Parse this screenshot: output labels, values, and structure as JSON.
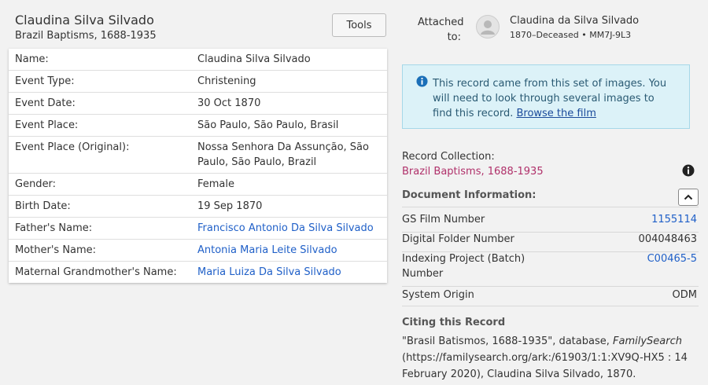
{
  "header": {
    "name": "Claudina Silva Silvado",
    "collection": "Brazil Baptisms, 1688-1935",
    "tools_label": "Tools"
  },
  "record_rows": [
    {
      "label": "Name:",
      "value": "Claudina Silva Silvado",
      "link": false
    },
    {
      "label": "Event Type:",
      "value": "Christening",
      "link": false
    },
    {
      "label": "Event Date:",
      "value": "30 Oct 1870",
      "link": false
    },
    {
      "label": "Event Place:",
      "value": "São Paulo, São Paulo, Brasil",
      "link": false
    },
    {
      "label": "Event Place (Original):",
      "value": "Nossa Senhora Da Assunção, São Paulo, São Paulo, Brazil",
      "link": false
    },
    {
      "label": "Gender:",
      "value": "Female",
      "link": false
    },
    {
      "label": "Birth Date:",
      "value": "19 Sep 1870",
      "link": false
    },
    {
      "label": "Father's Name:",
      "value": "Francisco Antonio Da Silva Silvado",
      "link": true
    },
    {
      "label": "Mother's Name:",
      "value": "Antonia Maria Leite Silvado",
      "link": true
    },
    {
      "label": "Maternal Grandmother's Name:",
      "value": "Maria Luiza Da Silva Silvado",
      "link": true
    }
  ],
  "attached": {
    "label_line1": "Attached",
    "label_line2": "to:",
    "person_name": "Claudina da Silva Silvado",
    "person_meta": "1870–Deceased • MM7J-9L3"
  },
  "info_box": {
    "text": "This record came from this set of images. You will need to look through several images to find this record.",
    "link_text": "Browse the film"
  },
  "record_collection": {
    "label": "Record Collection:",
    "value": "Brazil Baptisms, 1688-1935"
  },
  "document_info": {
    "title": "Document Information:",
    "rows": [
      {
        "label": "GS Film Number",
        "value": "1155114",
        "link": true
      },
      {
        "label": "Digital Folder Number",
        "value": "004048463",
        "link": false
      },
      {
        "label": "Indexing Project (Batch) Number",
        "value": "C00465-5",
        "link": true
      },
      {
        "label": "System Origin",
        "value": "ODM",
        "link": false
      }
    ]
  },
  "citing": {
    "title": "Citing this Record",
    "text_before": "\"Brasil Batismos, 1688-1935\", database, ",
    "text_italic": "FamilySearch",
    "text_after": " (https://familysearch.org/ark:/61903/1:1:XV9Q-HX5 : 14 February 2020), Claudina Silva Silvado, 1870."
  },
  "colors": {
    "link": "#2060c8",
    "collection": "#b0306a",
    "info_bg": "#dcf2f8",
    "info_icon": "#1a6fb8"
  }
}
